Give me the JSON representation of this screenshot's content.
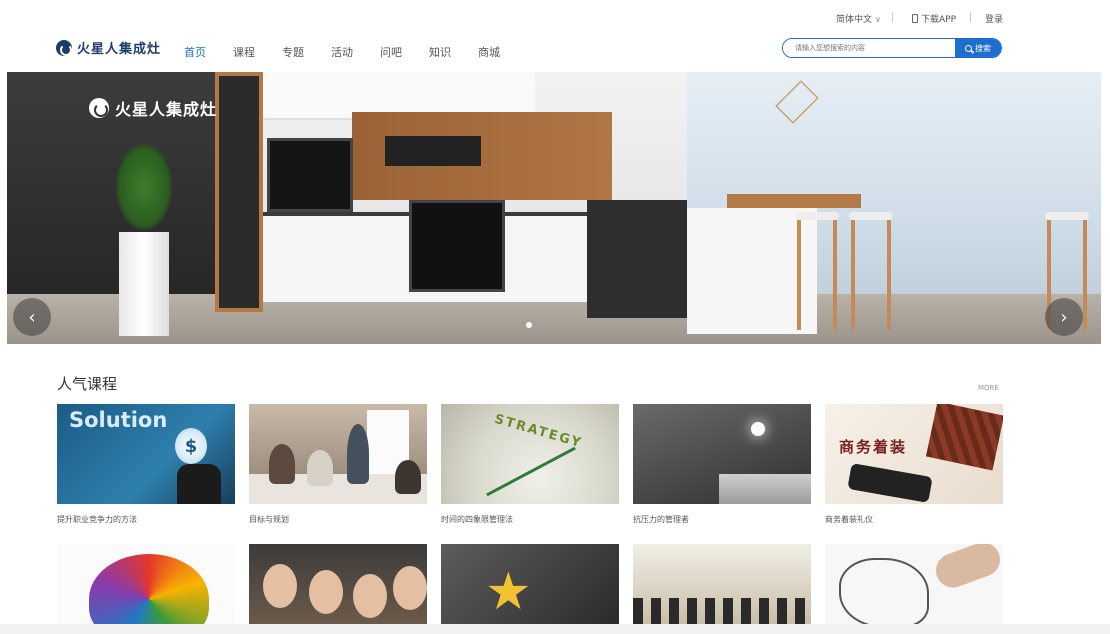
{
  "topbar": {
    "language": "简体中文",
    "download_app": "下载APP",
    "login": "登录"
  },
  "header": {
    "logo_text": "火星人集成灶",
    "nav": [
      "首页",
      "课程",
      "专题",
      "活动",
      "问吧",
      "知识",
      "商城"
    ],
    "active_nav_index": 0,
    "search_placeholder": "请输入您想搜索的内容",
    "search_button": "搜索"
  },
  "banner": {
    "logo_text": "火星人集成灶",
    "slide_count": 1
  },
  "popular_courses": {
    "title": "人气课程",
    "more": "MORE",
    "row1": [
      {
        "caption": "提升职业竞争力的方法",
        "thumb_text": "Solution"
      },
      {
        "caption": "目标与规划",
        "thumb_text": ""
      },
      {
        "caption": "时间的四象限管理法",
        "thumb_text": "STRATEGY"
      },
      {
        "caption": "抗压力的管理者",
        "thumb_text": ""
      },
      {
        "caption": "商务着装礼仪",
        "thumb_text": "商务着装"
      }
    ]
  },
  "colors": {
    "accent": "#1c6fd0",
    "brand": "#1d3c6e"
  }
}
